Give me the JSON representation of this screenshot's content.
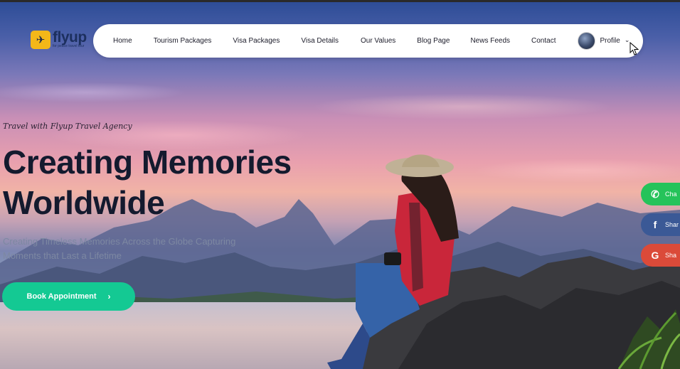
{
  "brand": {
    "name": "flyup",
    "tagline": "for peace travel tour",
    "accent": "#14c993",
    "logo_bg": "#f3b719"
  },
  "nav": {
    "items": [
      {
        "label": "Home"
      },
      {
        "label": "Tourism Packages"
      },
      {
        "label": "Visa Packages"
      },
      {
        "label": "Visa Details"
      },
      {
        "label": "Our Values"
      },
      {
        "label": "Blog Page"
      },
      {
        "label": "News Feeds"
      },
      {
        "label": "Contact"
      }
    ],
    "profile_label": "Profile"
  },
  "hero": {
    "tagline": "Travel with Flyup Travel Agency",
    "headline_line1": "Creating Memories",
    "headline_line2": "Worldwide",
    "subtext_line1": "Creating Timeless Memories Across the Globe Capturing",
    "subtext_line2": "Moments that Last a Lifetime",
    "cta_label": "Book Appointment"
  },
  "share": {
    "whatsapp": {
      "label": "Cha",
      "icon": "whatsapp-icon",
      "color": "#25c35a"
    },
    "facebook": {
      "label": "Shar",
      "icon": "facebook-icon",
      "color": "#3b5996"
    },
    "google": {
      "label": "Sha",
      "icon": "google-icon",
      "color": "#db4a39"
    }
  }
}
